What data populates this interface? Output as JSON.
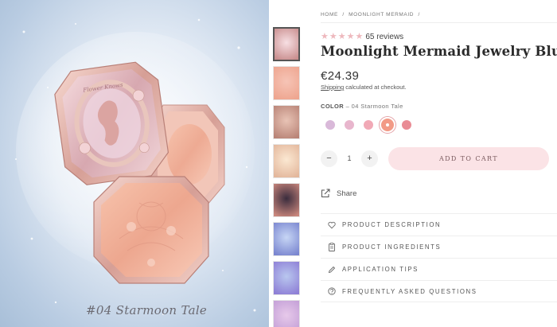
{
  "hero": {
    "caption": "#04 Starmoon Tale",
    "compact_lid_text": "Flower Knows"
  },
  "thumbnails": [
    {
      "name": "thumb-compact-closed",
      "colors": [
        "#f7dfe3",
        "#c98e8e"
      ],
      "active": true
    },
    {
      "name": "thumb-blush-pan",
      "colors": [
        "#f6c4b6",
        "#eea58f"
      ],
      "active": false
    },
    {
      "name": "thumb-swatch-strip",
      "colors": [
        "#e8c3b5",
        "#b98477"
      ],
      "active": false
    },
    {
      "name": "thumb-model-1",
      "colors": [
        "#fbe8d2",
        "#e3b79c"
      ],
      "active": false
    },
    {
      "name": "thumb-model-2",
      "colors": [
        "#3a2c3d",
        "#c9867c"
      ],
      "active": false
    },
    {
      "name": "thumb-blue-compact-1",
      "colors": [
        "#c7d6f5",
        "#7a86d0"
      ],
      "active": false
    },
    {
      "name": "thumb-blue-compact-2",
      "colors": [
        "#b9c7ef",
        "#8e7fd6"
      ],
      "active": false
    },
    {
      "name": "thumb-pink-compact",
      "colors": [
        "#e7c9ea",
        "#c39fd7"
      ],
      "active": false
    }
  ],
  "breadcrumb": [
    "HOME",
    "/",
    "MOONLIGHT MERMAID",
    "/"
  ],
  "rating": {
    "stars": 5,
    "reviews_text": "65 reviews"
  },
  "product": {
    "title": "Moonlight Mermaid Jewelry Blush",
    "price": "€24.39",
    "shipping_link": "Shipping",
    "shipping_rest": " calculated at checkout."
  },
  "variant": {
    "label": "COLOR",
    "selected": "04 Starmoon Tale",
    "separator": " – ",
    "swatches": [
      "#d9b9d9",
      "#e8b6cd",
      "#f1a9b6",
      "#f29a86",
      "#e98c95"
    ],
    "selected_index": 3
  },
  "cart": {
    "qty_minus": "−",
    "qty_value": "1",
    "qty_plus": "+",
    "add_label": "ADD TO CART"
  },
  "share_label": "Share",
  "accordion": [
    {
      "name": "product-description",
      "label": "PRODUCT DESCRIPTION",
      "icon": "heart-icon"
    },
    {
      "name": "product-ingredients",
      "label": "PRODUCT INGREDIENTS",
      "icon": "clipboard-icon"
    },
    {
      "name": "application-tips",
      "label": "APPLICATION TIPS",
      "icon": "pencil-icon"
    },
    {
      "name": "faq",
      "label": "FREQUENTLY ASKED QUESTIONS",
      "icon": "question-icon"
    }
  ],
  "colors": {
    "accent_pink": "#fbe3e6",
    "star_pink": "#eeb8bd",
    "text_dark": "#2a2a2a"
  }
}
